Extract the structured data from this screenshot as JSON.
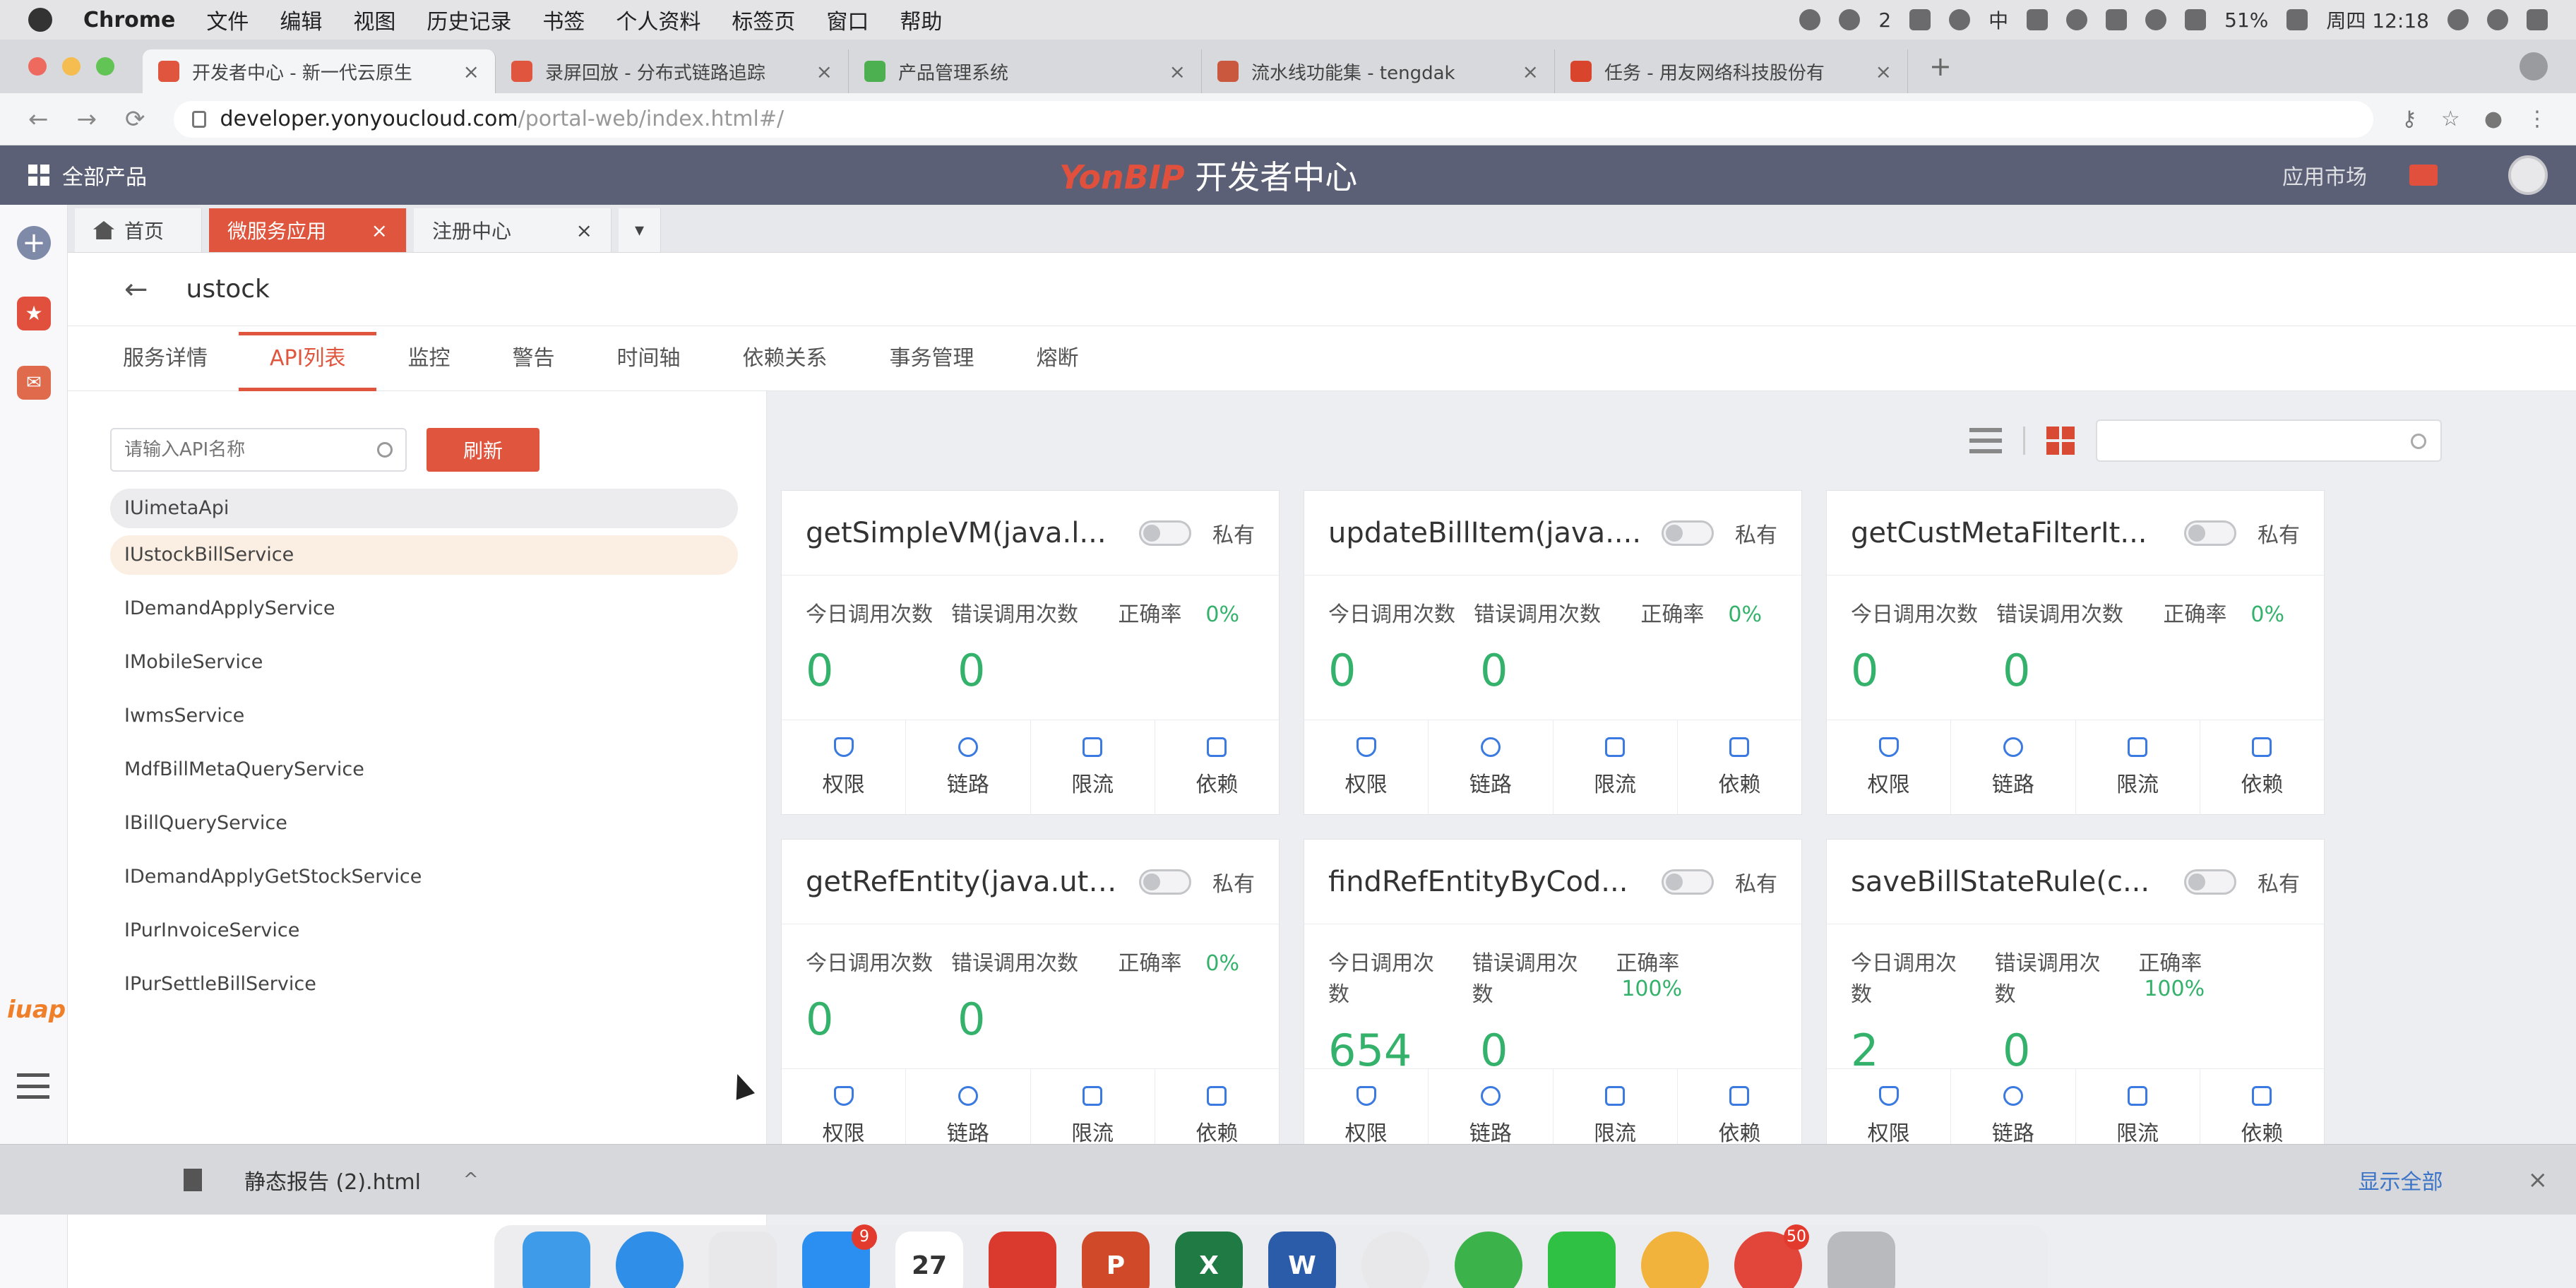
{
  "menubar": {
    "items": [
      "Chrome",
      "文件",
      "编辑",
      "视图",
      "历史记录",
      "书签",
      "个人资料",
      "标签页",
      "窗口",
      "帮助"
    ],
    "battery": "51%",
    "clock": "周四 12:18",
    "ime": "中",
    "wechat_count": "2"
  },
  "browser": {
    "tabs": [
      {
        "title": "开发者中心 - 新一代云原生",
        "color": "#e0553e"
      },
      {
        "title": "录屏回放 - 分布式链路追踪",
        "color": "#e0553e"
      },
      {
        "title": "产品管理系统",
        "color": "#4caf50"
      },
      {
        "title": "流水线功能集 - tengdak",
        "color": "#c9583f"
      },
      {
        "title": "任务 - 用友网络科技股份有",
        "color": "#d9442c"
      }
    ],
    "url_host": "developer.yonyoucloud.com",
    "url_path": "/portal-web/index.html#/"
  },
  "app": {
    "all_products": "全部产品",
    "brand_logo": "YonBIP",
    "brand_title": "开发者中心",
    "app_market": "应用市场",
    "left_logo": "iuap"
  },
  "page_tabs": {
    "home": "首页",
    "tab1": "微服务应用",
    "tab2": "注册中心",
    "close": "×",
    "more": "▾"
  },
  "service": {
    "back_arrow": "←",
    "name": "ustock",
    "tabs": [
      "服务详情",
      "API列表",
      "监控",
      "警告",
      "时间轴",
      "依赖关系",
      "事务管理",
      "熔断"
    ],
    "active_tab": 1
  },
  "sidebar": {
    "search_placeholder": "请输入API名称",
    "refresh": "刷新",
    "apis": [
      "IUimetaApi",
      "IUstockBillService",
      "IDemandApplyService",
      "IMobileService",
      "IwmsService",
      "MdfBillMetaQueryService",
      "IBillQueryService",
      "IDemandApplyGetStockService",
      "IPurInvoiceService",
      "IPurSettleBillService"
    ]
  },
  "labels": {
    "today_calls": "今日调用次数",
    "error_calls": "错误调用次数",
    "accuracy": "正确率",
    "private": "私有",
    "actions": [
      "权限",
      "链路",
      "限流",
      "依赖"
    ]
  },
  "cards": [
    {
      "name": "getSimpleVM(java.l...",
      "today": "0",
      "errors": "0",
      "rate": "0%"
    },
    {
      "name": "updateBillItem(java....",
      "today": "0",
      "errors": "0",
      "rate": "0%"
    },
    {
      "name": "getCustMetaFilterIt...",
      "today": "0",
      "errors": "0",
      "rate": "0%"
    },
    {
      "name": "getRefEntity(java.uti...",
      "today": "0",
      "errors": "0",
      "rate": "0%"
    },
    {
      "name": "findRefEntityByCod...",
      "today": "654",
      "errors": "0",
      "rate": "100%"
    },
    {
      "name": "saveBillStateRule(c...",
      "today": "2",
      "errors": "0",
      "rate": "100%"
    }
  ],
  "download": {
    "file": "静态报告 (2).html",
    "show_all": "显示全部",
    "close": "×"
  },
  "dock": {
    "appstore_badge": "9",
    "calendar_day": "27",
    "tencent_badge": "50"
  }
}
